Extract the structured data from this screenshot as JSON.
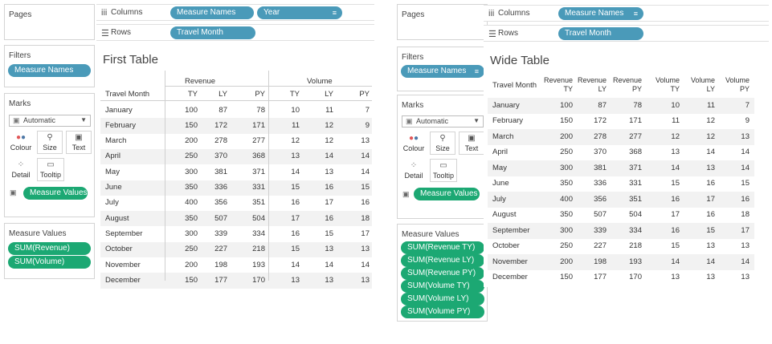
{
  "months": [
    "January",
    "February",
    "March",
    "April",
    "May",
    "June",
    "July",
    "August",
    "September",
    "October",
    "November",
    "December"
  ],
  "rows_data": [
    [
      100,
      87,
      78,
      10,
      11,
      7
    ],
    [
      150,
      172,
      171,
      11,
      12,
      9
    ],
    [
      200,
      278,
      277,
      12,
      12,
      13
    ],
    [
      250,
      370,
      368,
      13,
      14,
      14
    ],
    [
      300,
      381,
      371,
      14,
      13,
      14
    ],
    [
      350,
      336,
      331,
      15,
      16,
      15
    ],
    [
      400,
      356,
      351,
      16,
      17,
      16
    ],
    [
      350,
      507,
      504,
      17,
      16,
      18
    ],
    [
      300,
      339,
      334,
      16,
      15,
      17
    ],
    [
      250,
      227,
      218,
      15,
      13,
      13
    ],
    [
      200,
      198,
      193,
      14,
      14,
      14
    ],
    [
      150,
      177,
      170,
      13,
      13,
      13
    ]
  ],
  "cards": {
    "pages": "Pages",
    "filters": "Filters",
    "marks": "Marks",
    "measure_values": "Measure Values",
    "columns": "Columns",
    "rows": "Rows"
  },
  "marks": {
    "dropdown": "Automatic",
    "colour": "Colour",
    "size": "Size",
    "text": "Text",
    "detail": "Detail",
    "tooltip": "Tooltip"
  },
  "ws1": {
    "title": "First Table",
    "filter_pill": "Measure Names",
    "columns_pills": [
      "Measure Names",
      "Year"
    ],
    "rows_pill": "Travel Month",
    "text_pill": "Measure Values",
    "measure_values": [
      "SUM(Revenue)",
      "SUM(Volume)"
    ],
    "row_header": "Travel Month",
    "groups": [
      "Revenue",
      "Volume"
    ],
    "sub_headers": [
      "TY",
      "LY",
      "PY"
    ]
  },
  "ws2": {
    "title": "Wide Table",
    "filter_pill": "Measure Names",
    "columns_pill": "Measure Names",
    "rows_pill": "Travel Month",
    "text_pill": "Measure Values",
    "measure_values": [
      "SUM(Revenue TY)",
      "SUM(Revenue LY)",
      "SUM(Revenue PY)",
      "SUM(Volume TY)",
      "SUM(Volume LY)",
      "SUM(Volume PY)"
    ],
    "row_header": "Travel Month",
    "col_headers": [
      [
        "Revenue",
        "TY"
      ],
      [
        "Revenue",
        "LY"
      ],
      [
        "Revenue",
        "PY"
      ],
      [
        "Volume",
        "TY"
      ],
      [
        "Volume",
        "LY"
      ],
      [
        "Volume",
        "PY"
      ]
    ]
  },
  "colors": {
    "blue_pill": "#4a9ab9",
    "green_pill": "#1ca873",
    "stripe": "#f2f2f2"
  },
  "icons": {
    "columns": "columns-icon",
    "rows": "rows-icon",
    "colour": "color-dots-icon",
    "size": "size-icon",
    "text": "text-icon",
    "detail": "detail-dots-icon",
    "tooltip": "tooltip-icon",
    "sort": "sort-descending-icon"
  }
}
